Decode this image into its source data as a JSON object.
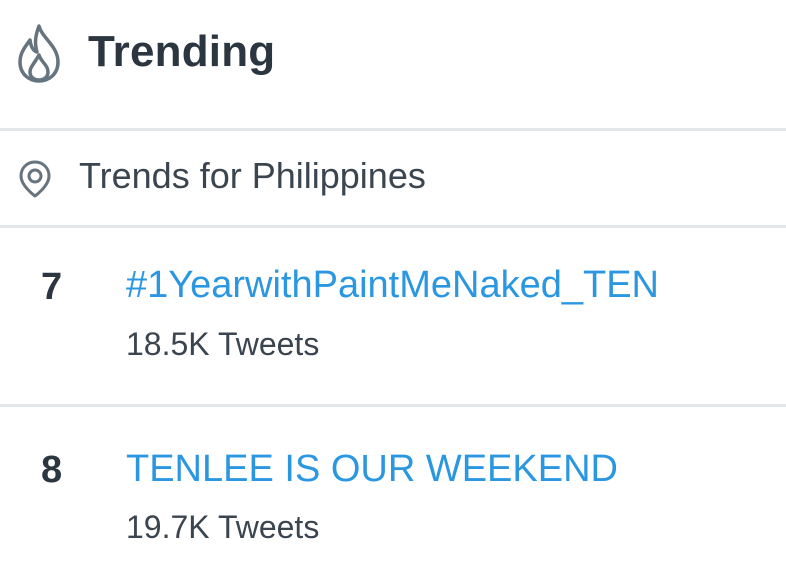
{
  "header": {
    "title": "Trending",
    "icon": "flame-icon"
  },
  "location": {
    "label": "Trends for Philippines",
    "icon": "location-pin-icon"
  },
  "trends": [
    {
      "rank": "7",
      "name": "#1YearwithPaintMeNaked_TEN",
      "count": "18.5K Tweets"
    },
    {
      "rank": "8",
      "name": "TENLEE IS OUR WEEKEND",
      "count": "19.7K Tweets"
    }
  ],
  "colors": {
    "accent": "#2b97e0",
    "text": "#2c3640",
    "divider": "#e3e7eb"
  }
}
